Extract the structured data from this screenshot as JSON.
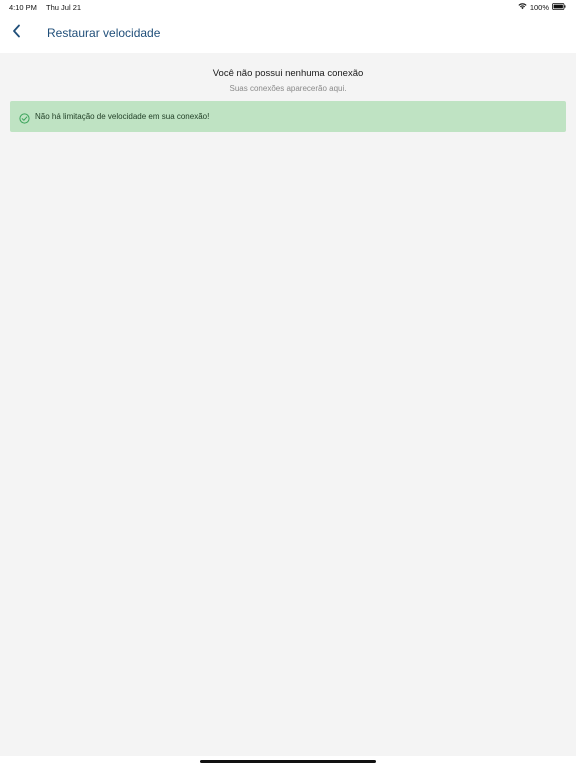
{
  "status_bar": {
    "time": "4:10 PM",
    "date": "Thu Jul 21",
    "battery_percent": "100%",
    "icons": [
      "wifi-icon",
      "battery-icon"
    ]
  },
  "nav": {
    "title": "Restaurar velocidade",
    "back_icon": "chevron-left-icon"
  },
  "empty_state": {
    "title": "Você não possui nenhuma conexão",
    "subtitle": "Suas conexões aparecerão aqui."
  },
  "alert": {
    "icon": "check-circle-icon",
    "text": "Não há limitação de velocidade em sua conexão!"
  },
  "colors": {
    "background": "#f4f4f4",
    "nav_title": "#1f4e79",
    "alert_background": "#bfe3c3",
    "alert_icon": "#3aa35a"
  }
}
